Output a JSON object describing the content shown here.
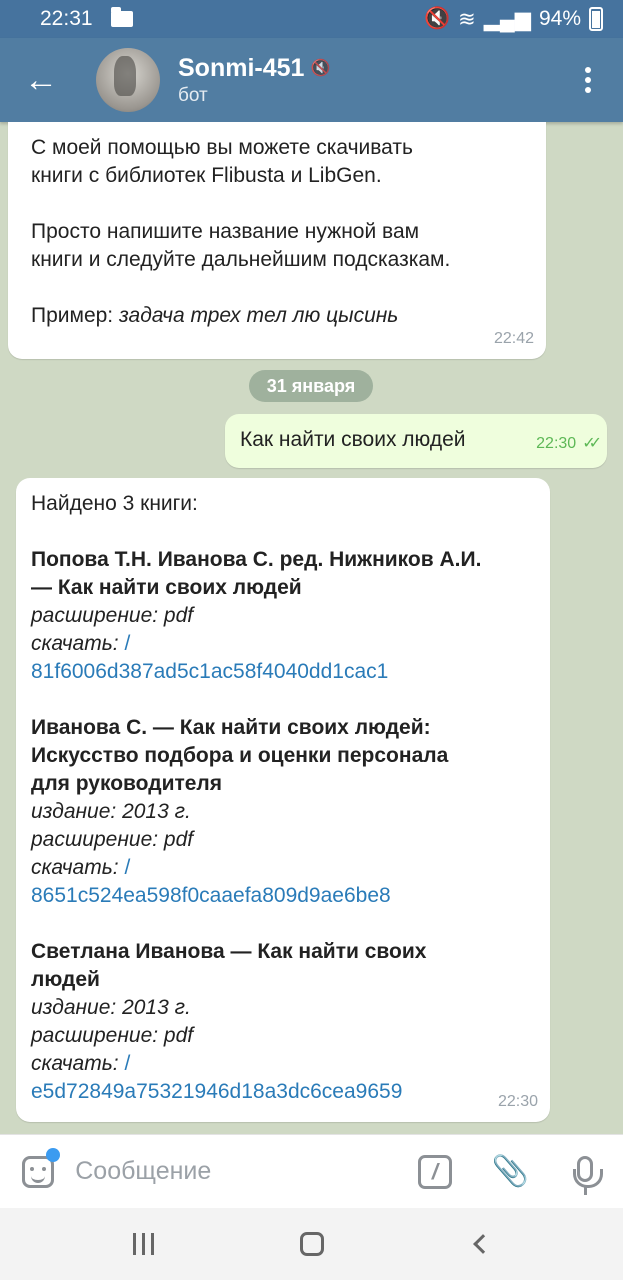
{
  "status_bar": {
    "time": "22:31",
    "battery": "94%"
  },
  "header": {
    "back_icon": "arrow-left",
    "title": "Sonmi-451",
    "subtitle": "бот"
  },
  "messages": {
    "bot_intro": {
      "line1": "С моей помощью вы можете скачивать",
      "line2": "книги с библиотек Flibusta и LibGen.",
      "line3": "Просто напишите название нужной вам",
      "line4": "книги и следуйте дальнейшим подсказкам.",
      "example_label": "Пример:",
      "example_text": "задача трех тел лю цысинь",
      "time": "22:42"
    },
    "date_separator": "31 января",
    "user_query": {
      "text": "Как найти своих людей",
      "time": "22:30"
    },
    "bot_results": {
      "found": "Найдено 3 книги:",
      "book1": {
        "title_line1": "Попова Т.Н. Иванова С. ред. Нижников А.И.",
        "title_line2": "— Как найти своих людей",
        "ext": "расширение: pdf",
        "download_label": "скачать:",
        "link_slash": "/",
        "link": "81f6006d387ad5c1ac58f4040dd1cac1"
      },
      "book2": {
        "title_line1": "Иванова С. — Как найти своих людей:",
        "title_line2": "Искусство подбора и оценки персонала",
        "title_line3": "для руководителя",
        "edition": "издание: 2013 г.",
        "ext": "расширение: pdf",
        "download_label": "скачать:",
        "link_slash": "/",
        "link": "8651c524ea598f0caaefa809d9ae6be8"
      },
      "book3": {
        "title_line1": "Светлана Иванова — Как найти своих",
        "title_line2": "людей",
        "edition": "издание: 2013 г.",
        "ext": "расширение: pdf",
        "download_label": "скачать:",
        "link_slash": "/",
        "link": "e5d72849a75321946d18a3dc6cea9659"
      },
      "time": "22:30"
    }
  },
  "input": {
    "placeholder": "Сообщение"
  },
  "colors": {
    "header": "#517da2",
    "status_bar": "#46739e",
    "outgoing_bubble": "#effedd",
    "link": "#2a7bb8",
    "check": "#5db856"
  }
}
